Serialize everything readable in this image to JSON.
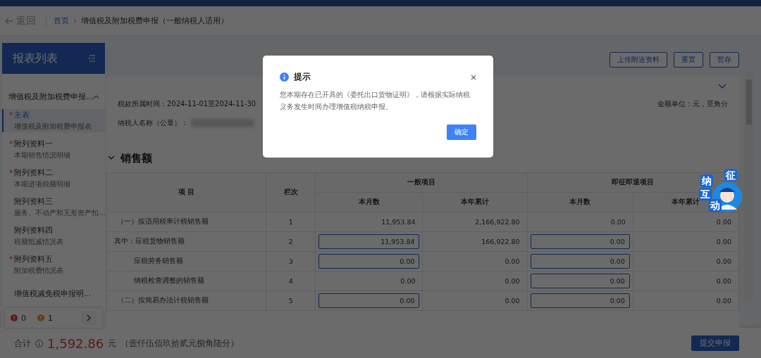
{
  "nav": {
    "back": "返回",
    "breadcrumb": [
      {
        "label": "首页",
        "kind": "link"
      },
      {
        "label": "增值税及附加税费申报（一般纳税人适用）",
        "kind": "current"
      }
    ]
  },
  "sidebar": {
    "title": "报表列表",
    "required_mark": "*",
    "group": {
      "label": "增值税及附加税费申报...",
      "expanded": true
    },
    "items": [
      {
        "label": "主表",
        "subtitle": "增值税及附加税费申报表",
        "required": true,
        "selected": true
      },
      {
        "label": "附列资料一",
        "subtitle": "本期销售情况明细",
        "required": true,
        "selected": false
      },
      {
        "label": "附列资料二",
        "subtitle": "本期进项税额明细",
        "required": true,
        "selected": false
      },
      {
        "label": "附列资料三",
        "subtitle": "服务、不动产和无形资产扣...",
        "required": false,
        "selected": false
      },
      {
        "label": "附列资料四",
        "subtitle": "税额抵减情况表",
        "required": false,
        "selected": false
      },
      {
        "label": "附列资料五",
        "subtitle": "附加税费情况表",
        "required": true,
        "selected": false
      },
      {
        "label": "增值税减免税申报明...",
        "required": false,
        "selected": false
      }
    ],
    "status": {
      "errors": "0",
      "warnings": "1"
    }
  },
  "toolbar": {
    "buttons": [
      "上传附送资料",
      "重置",
      "暂存"
    ]
  },
  "info": {
    "period": "税款所属时间：2024-11-01至2024-11-30",
    "unit": "金额单位：元，至角分",
    "taxpayer_label": "纳税人名称（公章）："
  },
  "section": {
    "title": "销售额",
    "expanded": true
  },
  "table": {
    "item_header": "项 目",
    "line_header": "栏次",
    "groups": [
      "一般项目",
      "即征即退项目"
    ],
    "sub_headers": [
      "本月数",
      "本年累计",
      "本月数",
      "本年累计"
    ],
    "rows": [
      {
        "label": "（一）按适用税率计税销售额",
        "kind": "main",
        "line": "1",
        "cells": [
          {
            "value": "11,953.84",
            "editable": false
          },
          {
            "value": "2,166,922.80",
            "editable": false
          },
          {
            "value": "0.00",
            "editable": false
          },
          {
            "value": "0.00",
            "editable": false
          }
        ]
      },
      {
        "label": "其中：应税货物销售额",
        "kind": "sub",
        "line": "2",
        "cells": [
          {
            "value": "11,953.84",
            "editable": true
          },
          {
            "value": "166,922.80",
            "editable": false
          },
          {
            "value": "0.00",
            "editable": true
          },
          {
            "value": "0.00",
            "editable": false
          }
        ]
      },
      {
        "label": "应税劳务销售额",
        "kind": "nested",
        "line": "3",
        "cells": [
          {
            "value": "0.00",
            "editable": true
          },
          {
            "value": "0.00",
            "editable": false
          },
          {
            "value": "0.00",
            "editable": true
          },
          {
            "value": "0.00",
            "editable": false
          }
        ]
      },
      {
        "label": "纳税检查调整的销售额",
        "kind": "nested",
        "line": "4",
        "cells": [
          {
            "value": "0.00",
            "editable": false
          },
          {
            "value": "0.00",
            "editable": false
          },
          {
            "value": "0.00",
            "editable": true
          },
          {
            "value": "0.00",
            "editable": false
          }
        ]
      },
      {
        "label": "（二）按简易办法计税销售额",
        "kind": "main",
        "line": "5",
        "cells": [
          {
            "value": "0.00",
            "editable": true
          },
          {
            "value": "0.00",
            "editable": false
          },
          {
            "value": "0.00",
            "editable": true
          },
          {
            "value": "0.00",
            "editable": false
          }
        ]
      }
    ]
  },
  "footer": {
    "total_label": "合计",
    "amount": "1,592.86",
    "currency": "元",
    "amount_words": "（壹仟伍佰玖拾贰元捌角陆分）",
    "submit": "提交申报"
  },
  "mascot": {
    "chars": [
      "征",
      "纳",
      "互",
      "动"
    ]
  },
  "dialog": {
    "title": "提示",
    "message": "您本期存在已开具的《委托出口货物证明》，请根据实际纳税义务发生时间办理增值税纳税申报。",
    "confirm": "确定"
  }
}
